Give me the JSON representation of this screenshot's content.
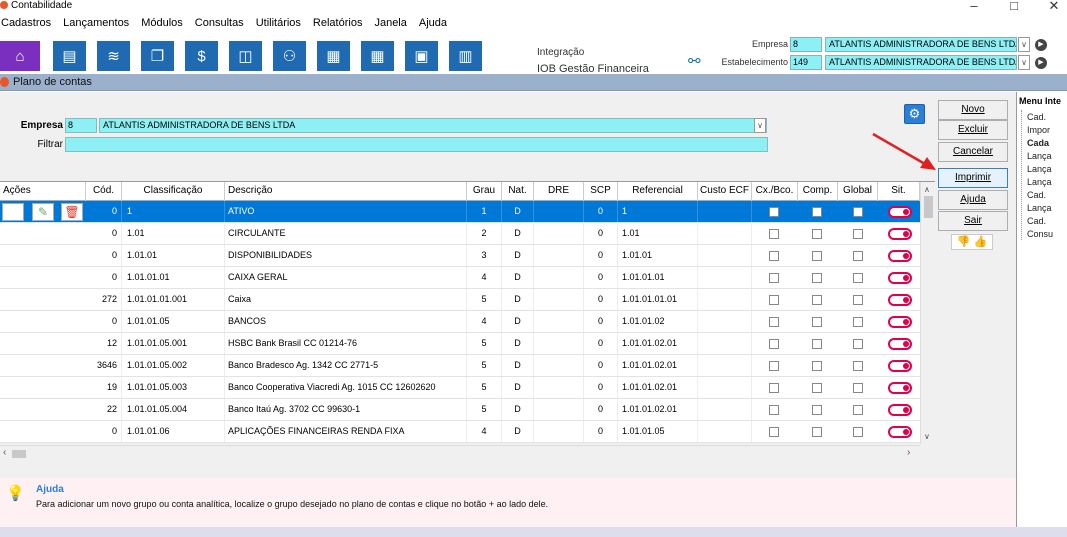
{
  "window": {
    "title": "Contabilidade",
    "min": "–",
    "max": "□",
    "close": "✕"
  },
  "menu": [
    "Cadastros",
    "Lançamentos",
    "Módulos",
    "Consultas",
    "Utilitários",
    "Relatórios",
    "Janela",
    "Ajuda"
  ],
  "toolbar": {
    "integracao_label": "Integração",
    "integracao_sub": "IOB Gestão Financeira",
    "empresa_label": "Empresa",
    "empresa_code": "8",
    "empresa_name": "ATLANTIS ADMINISTRADORA DE BENS LTDA",
    "estab_label": "Estabelecimento",
    "estab_code": "149",
    "estab_name": "ATLANTIS ADMINISTRADORA DE BENS LTDA"
  },
  "form": {
    "title": "Plano de contas",
    "empresa_label": "Empresa",
    "empresa_code": "8",
    "empresa_name": "ATLANTIS ADMINISTRADORA DE BENS LTDA",
    "filtrar_label": "Filtrar",
    "filtrar_value": ""
  },
  "buttons": {
    "novo": "Novo",
    "excluir": "Excluir",
    "cancelar": "Cancelar",
    "imprimir": "Imprimir",
    "ajuda": "Ajuda",
    "sair": "Sair"
  },
  "right_panel": {
    "title": "Menu Inte",
    "items": [
      "Cad.",
      "Impor",
      "Cada",
      "Lança",
      "Lança",
      "Lança",
      "Cad.",
      "Lança",
      "Cad.",
      "Consu"
    ]
  },
  "grid": {
    "columns": [
      "Ações",
      "Cód.",
      "Classificação",
      "Descrição",
      "Grau",
      "Nat.",
      "DRE",
      "SCP",
      "Referencial",
      "Custo ECF",
      "Cx./Bco.",
      "Comp.",
      "Global",
      "Sit."
    ],
    "rows": [
      {
        "cod": "0",
        "class": "1",
        "desc": "ATIVO",
        "grau": "1",
        "nat": "D",
        "dre": "",
        "scp": "0",
        "ref": "1",
        "selected": true
      },
      {
        "cod": "0",
        "class": "1.01",
        "desc": "CIRCULANTE",
        "grau": "2",
        "nat": "D",
        "dre": "",
        "scp": "0",
        "ref": "1.01",
        "selected": false
      },
      {
        "cod": "0",
        "class": "1.01.01",
        "desc": "DISPONIBILIDADES",
        "grau": "3",
        "nat": "D",
        "dre": "",
        "scp": "0",
        "ref": "1.01.01",
        "selected": false
      },
      {
        "cod": "0",
        "class": "1.01.01.01",
        "desc": "CAIXA GERAL",
        "grau": "4",
        "nat": "D",
        "dre": "",
        "scp": "0",
        "ref": "1.01.01.01",
        "selected": false
      },
      {
        "cod": "272",
        "class": "1.01.01.01.001",
        "desc": "Caixa",
        "grau": "5",
        "nat": "D",
        "dre": "",
        "scp": "0",
        "ref": "1.01.01.01.01",
        "selected": false
      },
      {
        "cod": "0",
        "class": "1.01.01.05",
        "desc": "BANCOS",
        "grau": "4",
        "nat": "D",
        "dre": "",
        "scp": "0",
        "ref": "1.01.01.02",
        "selected": false
      },
      {
        "cod": "12",
        "class": "1.01.01.05.001",
        "desc": "HSBC Bank Brasil CC 01214-76",
        "grau": "5",
        "nat": "D",
        "dre": "",
        "scp": "0",
        "ref": "1.01.01.02.01",
        "selected": false
      },
      {
        "cod": "3646",
        "class": "1.01.01.05.002",
        "desc": "Banco Bradesco Ag. 1342 CC 2771-5",
        "grau": "5",
        "nat": "D",
        "dre": "",
        "scp": "0",
        "ref": "1.01.01.02.01",
        "selected": false
      },
      {
        "cod": "19",
        "class": "1.01.01.05.003",
        "desc": "Banco Cooperativa Viacredi Ag. 1015 CC 12602620",
        "grau": "5",
        "nat": "D",
        "dre": "",
        "scp": "0",
        "ref": "1.01.01.02.01",
        "selected": false
      },
      {
        "cod": "22",
        "class": "1.01.01.05.004",
        "desc": "Banco Itaú Ag. 3702 CC 99630-1",
        "grau": "5",
        "nat": "D",
        "dre": "",
        "scp": "0",
        "ref": "1.01.01.02.01",
        "selected": false
      },
      {
        "cod": "0",
        "class": "1.01.01.06",
        "desc": "APLICAÇÕES FINANCEIRAS RENDA FIXA",
        "grau": "4",
        "nat": "D",
        "dre": "",
        "scp": "0",
        "ref": "1.01.01.05",
        "selected": false
      }
    ]
  },
  "help": {
    "title": "Ajuda",
    "text": "Para adicionar um novo grupo ou conta analítica, localize o grupo desejado no plano de contas e clique no botão + ao lado dele."
  },
  "colors": {
    "cyan_field": "#8cf0f4",
    "selection": "#0078d7",
    "toggle": "#e0004b",
    "toolbar_blue": "#1f6ab0",
    "toolbar_purple": "#7b2fbf"
  }
}
